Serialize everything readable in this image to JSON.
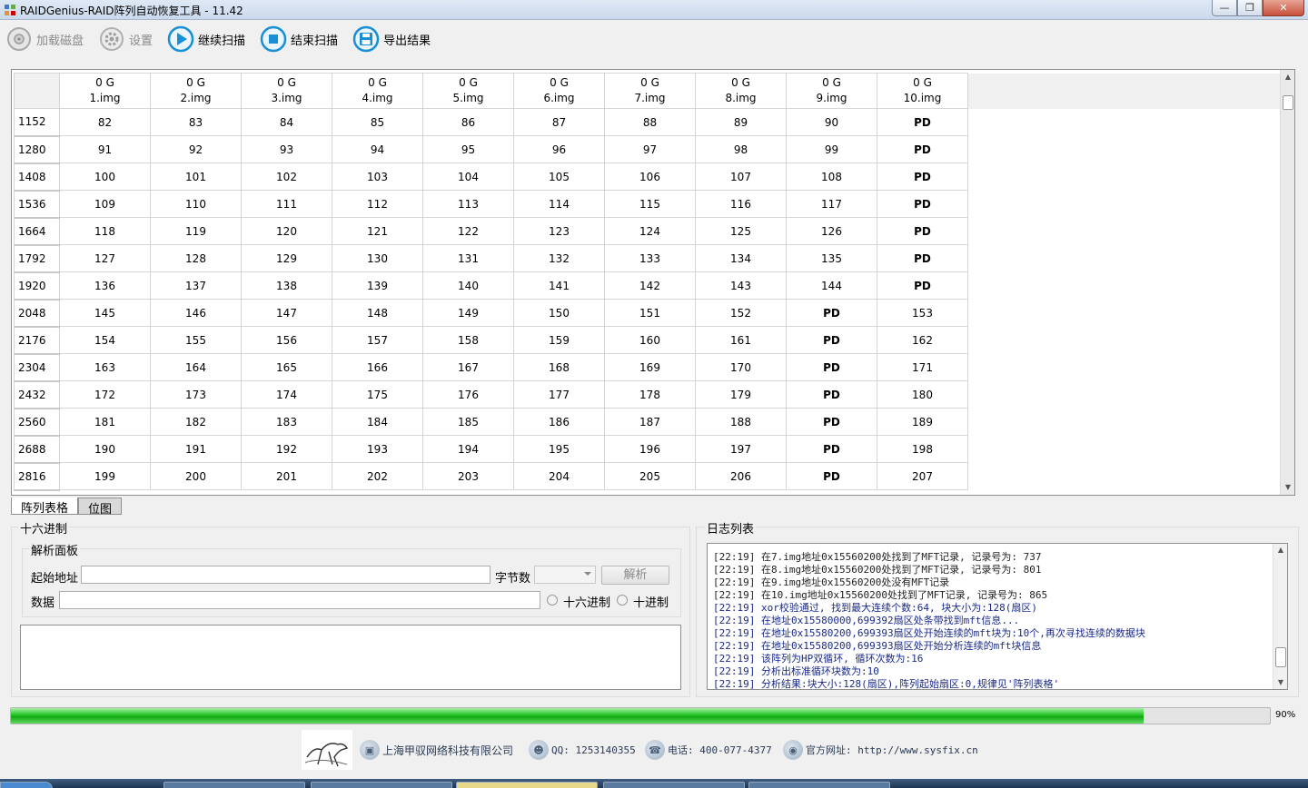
{
  "window": {
    "title": "RAIDGenius-RAID阵列自动恢复工具 - 11.42"
  },
  "toolbar": [
    {
      "label": "加载磁盘",
      "icon": "load-disk-icon",
      "enabled": false
    },
    {
      "label": "设置",
      "icon": "gear-icon",
      "enabled": false
    },
    {
      "label": "继续扫描",
      "icon": "play-icon",
      "enabled": true
    },
    {
      "label": "结束扫描",
      "icon": "stop-icon",
      "enabled": true
    },
    {
      "label": "导出结果",
      "icon": "save-icon",
      "enabled": true
    }
  ],
  "grid": {
    "columns": [
      {
        "size": "0 G",
        "name": "1.img"
      },
      {
        "size": "0 G",
        "name": "2.img"
      },
      {
        "size": "0 G",
        "name": "3.img"
      },
      {
        "size": "0 G",
        "name": "4.img"
      },
      {
        "size": "0 G",
        "name": "5.img"
      },
      {
        "size": "0 G",
        "name": "6.img"
      },
      {
        "size": "0 G",
        "name": "7.img"
      },
      {
        "size": "0 G",
        "name": "8.img"
      },
      {
        "size": "0 G",
        "name": "9.img"
      },
      {
        "size": "0 G",
        "name": "10.img"
      }
    ],
    "rows": [
      {
        "offset": "1152",
        "cells": [
          "82",
          "83",
          "84",
          "85",
          "86",
          "87",
          "88",
          "89",
          "90",
          "PD"
        ]
      },
      {
        "offset": "1280",
        "cells": [
          "91",
          "92",
          "93",
          "94",
          "95",
          "96",
          "97",
          "98",
          "99",
          "PD"
        ]
      },
      {
        "offset": "1408",
        "cells": [
          "100",
          "101",
          "102",
          "103",
          "104",
          "105",
          "106",
          "107",
          "108",
          "PD"
        ]
      },
      {
        "offset": "1536",
        "cells": [
          "109",
          "110",
          "111",
          "112",
          "113",
          "114",
          "115",
          "116",
          "117",
          "PD"
        ]
      },
      {
        "offset": "1664",
        "cells": [
          "118",
          "119",
          "120",
          "121",
          "122",
          "123",
          "124",
          "125",
          "126",
          "PD"
        ]
      },
      {
        "offset": "1792",
        "cells": [
          "127",
          "128",
          "129",
          "130",
          "131",
          "132",
          "133",
          "134",
          "135",
          "PD"
        ]
      },
      {
        "offset": "1920",
        "cells": [
          "136",
          "137",
          "138",
          "139",
          "140",
          "141",
          "142",
          "143",
          "144",
          "PD"
        ]
      },
      {
        "offset": "2048",
        "cells": [
          "145",
          "146",
          "147",
          "148",
          "149",
          "150",
          "151",
          "152",
          "PD",
          "153"
        ]
      },
      {
        "offset": "2176",
        "cells": [
          "154",
          "155",
          "156",
          "157",
          "158",
          "159",
          "160",
          "161",
          "PD",
          "162"
        ]
      },
      {
        "offset": "2304",
        "cells": [
          "163",
          "164",
          "165",
          "166",
          "167",
          "168",
          "169",
          "170",
          "PD",
          "171"
        ]
      },
      {
        "offset": "2432",
        "cells": [
          "172",
          "173",
          "174",
          "175",
          "176",
          "177",
          "178",
          "179",
          "PD",
          "180"
        ]
      },
      {
        "offset": "2560",
        "cells": [
          "181",
          "182",
          "183",
          "184",
          "185",
          "186",
          "187",
          "188",
          "PD",
          "189"
        ]
      },
      {
        "offset": "2688",
        "cells": [
          "190",
          "191",
          "192",
          "193",
          "194",
          "195",
          "196",
          "197",
          "PD",
          "198"
        ]
      },
      {
        "offset": "2816",
        "cells": [
          "199",
          "200",
          "201",
          "202",
          "203",
          "204",
          "205",
          "206",
          "PD",
          "207"
        ]
      }
    ]
  },
  "tabs": {
    "table": "阵列表格",
    "bitmap": "位图"
  },
  "hex": {
    "group_title": "十六进制",
    "parse_panel_title": "解析面板",
    "start_addr_label": "起始地址",
    "start_addr_value": "",
    "bytes_label": "字节数",
    "bytes_value": "",
    "parse_button": "解析",
    "data_label": "数据",
    "data_value": "",
    "radio_hex": "十六进制",
    "radio_dec": "十进制"
  },
  "log": {
    "title": "日志列表",
    "lines": [
      {
        "text": "[22:19] 在7.img地址0x15560200处找到了MFT记录, 记录号为: 737",
        "color": "normal"
      },
      {
        "text": "[22:19] 在8.img地址0x15560200处找到了MFT记录, 记录号为: 801",
        "color": "normal"
      },
      {
        "text": "[22:19] 在9.img地址0x15560200处没有MFT记录",
        "color": "normal"
      },
      {
        "text": "[22:19] 在10.img地址0x15560200处找到了MFT记录, 记录号为: 865",
        "color": "normal"
      },
      {
        "text": "[22:19] xor校验通过, 找到最大连续个数:64, 块大小为:128(扇区)",
        "color": "blue"
      },
      {
        "text": "[22:19] 在地址0x15580000,699392扇区处条带找到mft信息...",
        "color": "blue"
      },
      {
        "text": "[22:19] 在地址0x15580200,699393扇区处开始连续的mft块为:10个,再次寻找连续的数据块",
        "color": "blue"
      },
      {
        "text": "[22:19] 在地址0x15580200,699393扇区处开始分析连续的mft块信息",
        "color": "blue"
      },
      {
        "text": "[22:19] 该阵列为HP双循环, 循环次数为:16",
        "color": "blue"
      },
      {
        "text": "[22:19] 分析出标准循环块数为:10",
        "color": "blue"
      },
      {
        "text": "[22:19] 分析结果:块大小:128(扇区),阵列起始扇区:0,规律见'阵列表格'",
        "color": "blue"
      }
    ]
  },
  "progress": {
    "value": 0.9,
    "label": "90%"
  },
  "footer": {
    "company": "上海甲驭网络科技有限公司",
    "qq": "QQ: 1253140355",
    "phone": "电话: 400-077-4377",
    "website": "官方网址: http://www.sysfix.cn"
  },
  "colors": {
    "progress_green": "#1eb51e",
    "play_blue": "#1a8fd6",
    "log_blue": "#1a2a8a"
  }
}
